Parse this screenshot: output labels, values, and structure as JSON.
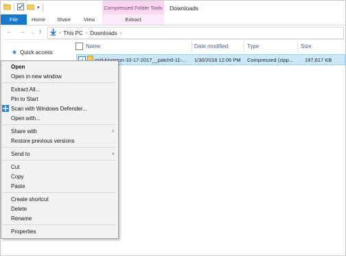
{
  "window": {
    "title": "Downloads",
    "context_tab_group": "Compressed Folder Tools"
  },
  "ribbon": {
    "tabs": [
      "File",
      "Home",
      "Share",
      "View",
      "Extract"
    ]
  },
  "address": {
    "crumbs": [
      "This PC",
      "Downloads"
    ]
  },
  "nav_pane": {
    "quick_access": "Quick access"
  },
  "columns": {
    "name": "Name",
    "date_modified": "Date modified",
    "type": "Type",
    "size": "Size"
  },
  "file": {
    "name": "mid-kingston-10-17-2017__patch0-11-...",
    "date_modified": "1/30/2018 12:06 PM",
    "type": "Compressed (zipp...",
    "size": "197,617 KB"
  },
  "context_menu": {
    "open": "Open",
    "open_new_window": "Open in new window",
    "extract_all": "Extract All...",
    "pin_to_start": "Pin to Start",
    "scan_defender": "Scan with Windows Defender...",
    "open_with": "Open with...",
    "share_with": "Share with",
    "restore_previous": "Restore previous versions",
    "send_to": "Send to",
    "cut": "Cut",
    "copy": "Copy",
    "paste": "Paste",
    "create_shortcut": "Create shortcut",
    "delete": "Delete",
    "rename": "Rename",
    "properties": "Properties"
  },
  "colors": {
    "file_tab": "#1979ca",
    "context_tab": "#f7d7f0",
    "selection": "#cce8ff",
    "menu_bg": "#f2f2f2"
  }
}
